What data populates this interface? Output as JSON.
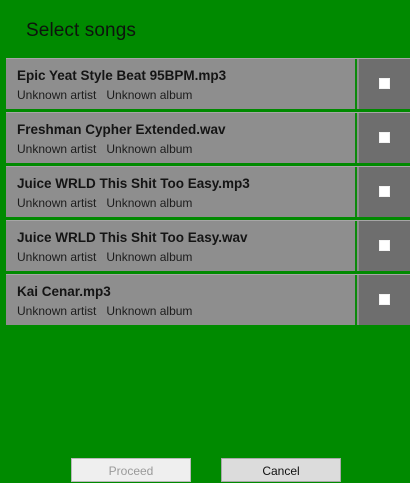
{
  "dialog": {
    "title": "Select songs"
  },
  "songs": [
    {
      "title": "Epic Yeat Style Beat 95BPM.mp3",
      "artist": "Unknown artist",
      "album": "Unknown album",
      "selected": false
    },
    {
      "title": "Freshman Cypher Extended.wav",
      "artist": "Unknown artist",
      "album": "Unknown album",
      "selected": false
    },
    {
      "title": "Juice WRLD This Shit Too Easy.mp3",
      "artist": "Unknown artist",
      "album": "Unknown album",
      "selected": false
    },
    {
      "title": "Juice WRLD This Shit Too Easy.wav",
      "artist": "Unknown artist",
      "album": "Unknown album",
      "selected": false
    },
    {
      "title": "Kai Cenar.mp3",
      "artist": "Unknown artist",
      "album": "Unknown album",
      "selected": false
    }
  ],
  "buttons": {
    "proceed_label": "Proceed",
    "proceed_enabled": false,
    "cancel_label": "Cancel"
  },
  "colors": {
    "background": "#008a00",
    "row": "#8e8e8e",
    "checkbox_cell": "#6e6e6e"
  }
}
